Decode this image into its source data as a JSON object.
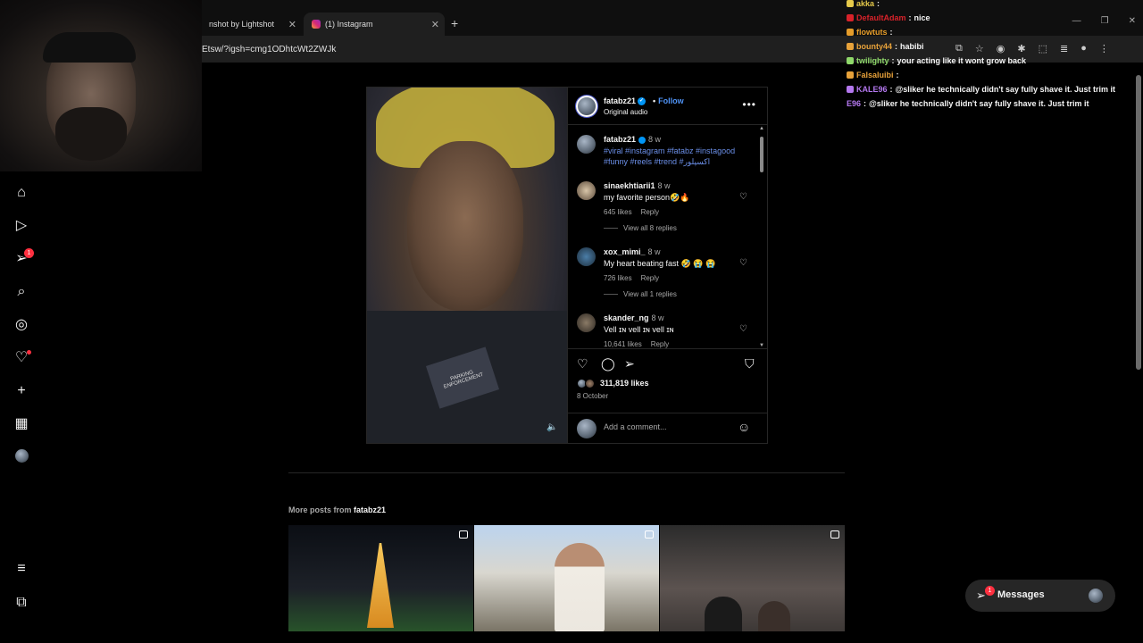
{
  "browser": {
    "tabs": [
      {
        "label": "nshot by Lightshot"
      },
      {
        "label": "(1) Instagram"
      }
    ],
    "new_tab": "+",
    "url": "Etsw/?igsh=cmg1ODhtcWt2ZWJk"
  },
  "chat": [
    {
      "user": "akka",
      "message": "",
      "color": "#e5c94a"
    },
    {
      "user": "DefaultAdam",
      "message": "nice",
      "color": "#d8222a"
    },
    {
      "user": "flowtuts",
      "message": "",
      "color": "#e59c2a"
    },
    {
      "user": "bounty44",
      "message": "habibi",
      "color": "#e8a23a"
    },
    {
      "user": "twilighty",
      "message": "your acting like it wont grow back",
      "color": "#8fd86a"
    },
    {
      "user": "Falsaluibi",
      "message": "",
      "color": "#e8a23a"
    },
    {
      "user": "KALE96",
      "message": "@sliker he technically didn't say fully shave it. Just trim it",
      "color": "#b478ef"
    },
    {
      "user": "E96",
      "message": "@sliker he technically didn't say fully shave it. Just trim it",
      "color": "#b478ef"
    }
  ],
  "sidebar": {
    "items": [
      {
        "name": "home",
        "icon": "⌂"
      },
      {
        "name": "reels",
        "icon": "▷"
      },
      {
        "name": "messages",
        "icon": "➢",
        "badge": "1"
      },
      {
        "name": "search",
        "icon": "⌕"
      },
      {
        "name": "explore",
        "icon": "◎"
      },
      {
        "name": "notifications",
        "icon": "♡"
      },
      {
        "name": "create",
        "icon": "+"
      },
      {
        "name": "dashboard",
        "icon": "▦"
      }
    ],
    "more_icon": "≡",
    "also_from_meta_icon": "⧉"
  },
  "post": {
    "username": "fatabz21",
    "follow_label": "Follow",
    "audio": "Original audio",
    "caption_time": "8 w",
    "caption": "#viral #instagram #fatabz #instagood #funny #reels #trend #اکسپلور",
    "patch_text": "PARKING ENFORCEMENT",
    "comments": [
      {
        "user": "sinaekhtiarii1",
        "time": "8 w",
        "text": "my favorite person🤣🔥",
        "likes": "645 likes",
        "reply": "Reply",
        "replies": "View all 8 replies"
      },
      {
        "user": "xox_mimi_",
        "time": "8 w",
        "text": "My heart beating fast 🤣 😭 😭",
        "likes": "726 likes",
        "reply": "Reply",
        "replies": "View all 1 replies"
      },
      {
        "user": "skander_ng",
        "time": "8 w",
        "text": "Vell ɪɴ vell ɪɴ vell ɪɴ",
        "likes": "10,641 likes",
        "reply": "Reply"
      }
    ],
    "likes": "311,819 likes",
    "date": "8 October",
    "comment_placeholder": "Add a comment..."
  },
  "more_posts": {
    "prefix": "More posts from",
    "username": "fatabz21"
  },
  "messages_pill": {
    "label": "Messages",
    "badge": "1"
  }
}
